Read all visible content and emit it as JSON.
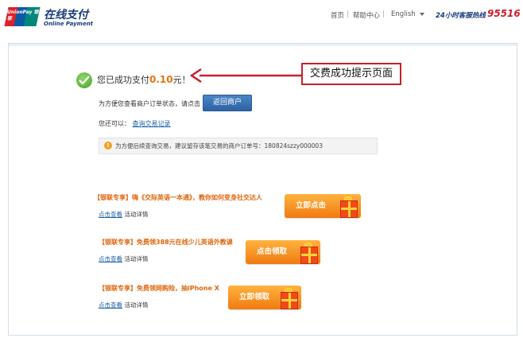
{
  "header": {
    "logo_card_text": "UnionPay 银联",
    "logo_cn": "在线支付",
    "logo_en": "Online Payment",
    "nav_home": "首页",
    "nav_help": "帮助中心",
    "separator": "|",
    "nav_lang": "English",
    "hotline_label": "24小时客服热线",
    "hotline_number": "95516"
  },
  "success": {
    "prefix": "您已成功支付",
    "amount": "0.10",
    "suffix": "元！"
  },
  "callout": "交费成功提示页面",
  "hint_order": "为方便您查看商户订单状态，请点击",
  "back_button": "返回商户",
  "hint_query_prefix": "您还可以：",
  "hint_query_link": "查询交易记录",
  "notice": {
    "icon": "!",
    "text": "为方便后续查询交易，建议留存该笔交易的商户订单号：180824szzy000003"
  },
  "promos": [
    {
      "title": "【银联专享】嗨《交际英语一本通》，教你如何变身社交达人",
      "link": "点击查看",
      "detail": "活动详情",
      "button": "立即点击"
    },
    {
      "title": "【银联专享】免费领388元在线少儿英语外教课",
      "link": "点击查看",
      "detail": "活动详情",
      "button": "点击领取"
    },
    {
      "title": "【银联专享】免费领网购险，抽iPhone X",
      "link": "点击查看",
      "detail": "活动详情",
      "button": "立即领取"
    }
  ],
  "colors": {
    "accent_orange": "#e8730f",
    "brand_red": "#c8202b",
    "button_blue": "#2e62a3"
  }
}
